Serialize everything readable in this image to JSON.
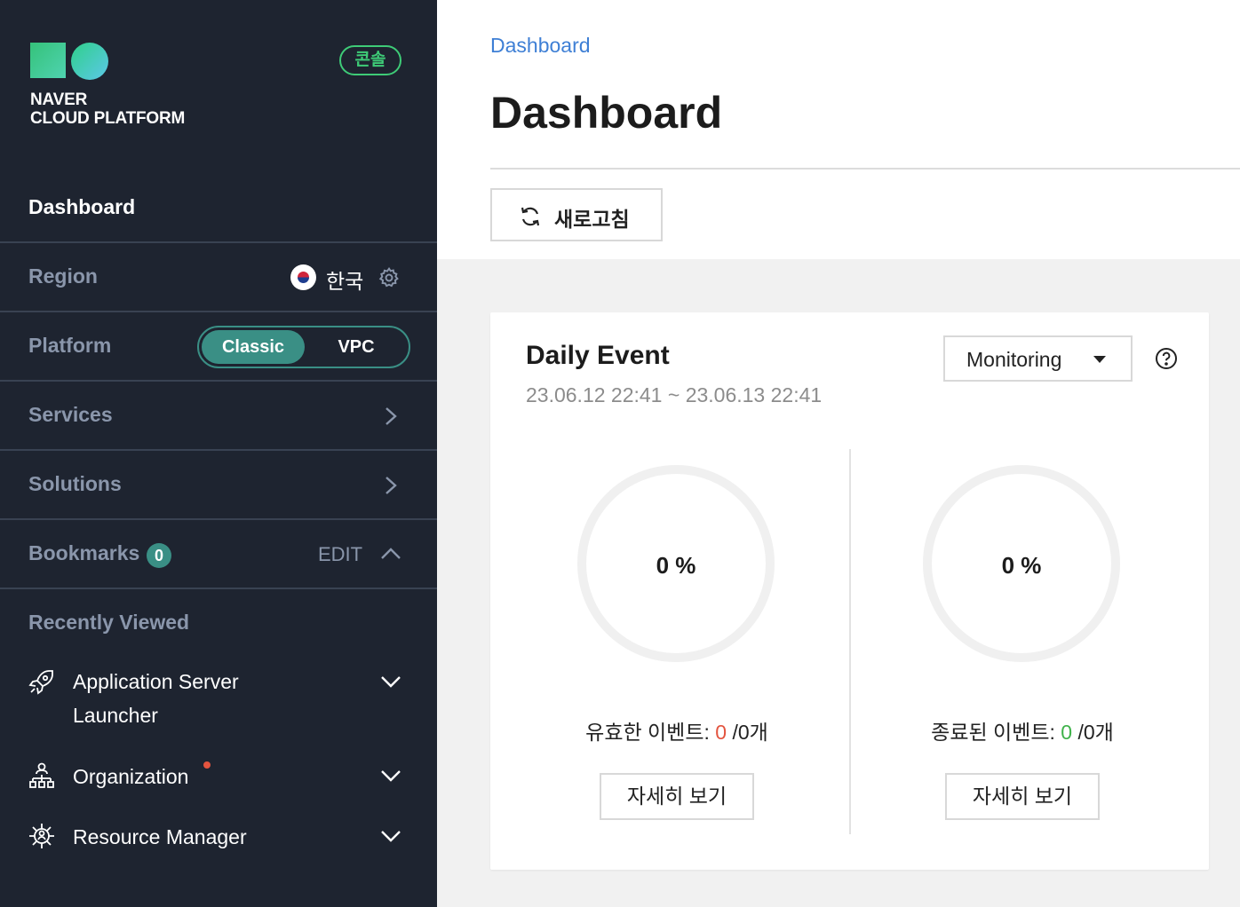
{
  "sidebar": {
    "logo_line1": "NAVER",
    "logo_line2": "CLOUD PLATFORM",
    "console_badge": "콘솔",
    "dashboard": "Dashboard",
    "region": {
      "label": "Region",
      "value": "한국",
      "flag_icon": "korea-flag-icon",
      "settings_icon": "gear-icon"
    },
    "platform": {
      "label": "Platform",
      "options": [
        "Classic",
        "VPC"
      ],
      "selected": "Classic"
    },
    "services": {
      "label": "Services"
    },
    "solutions": {
      "label": "Solutions"
    },
    "bookmarks": {
      "label": "Bookmarks",
      "count": "0",
      "edit": "EDIT"
    },
    "recently_viewed": {
      "label": "Recently Viewed",
      "items": [
        {
          "line1": "Application Server",
          "line2": "Launcher",
          "icon": "rocket-icon"
        },
        {
          "line1": "Organization",
          "icon": "org-chart-icon",
          "has_notification": true
        },
        {
          "line1": "Resource Manager",
          "icon": "resource-manager-icon"
        }
      ]
    }
  },
  "main": {
    "breadcrumb": "Dashboard",
    "title": "Dashboard",
    "refresh_label": "새로고침",
    "card": {
      "title": "Daily Event",
      "range": "23.06.12 22:41 ~ 23.06.13 22:41",
      "select_value": "Monitoring",
      "help_icon": "help-circle-icon",
      "gauges": [
        {
          "pct": "0 %",
          "label": "유효한 이벤트: ",
          "count": "0",
          "total": " /0개",
          "button": "자세히 보기"
        },
        {
          "pct": "0 %",
          "label": "종료된 이벤트: ",
          "count": "0",
          "total": " /0개",
          "button": "자세히 보기"
        }
      ]
    }
  },
  "colors": {
    "sidebar_bg": "#1e2430",
    "accent_teal": "#3a8f85",
    "accent_green": "#3ecb77",
    "link_blue": "#3e7fd5",
    "red": "#e3543f",
    "green": "#3fb24a"
  }
}
